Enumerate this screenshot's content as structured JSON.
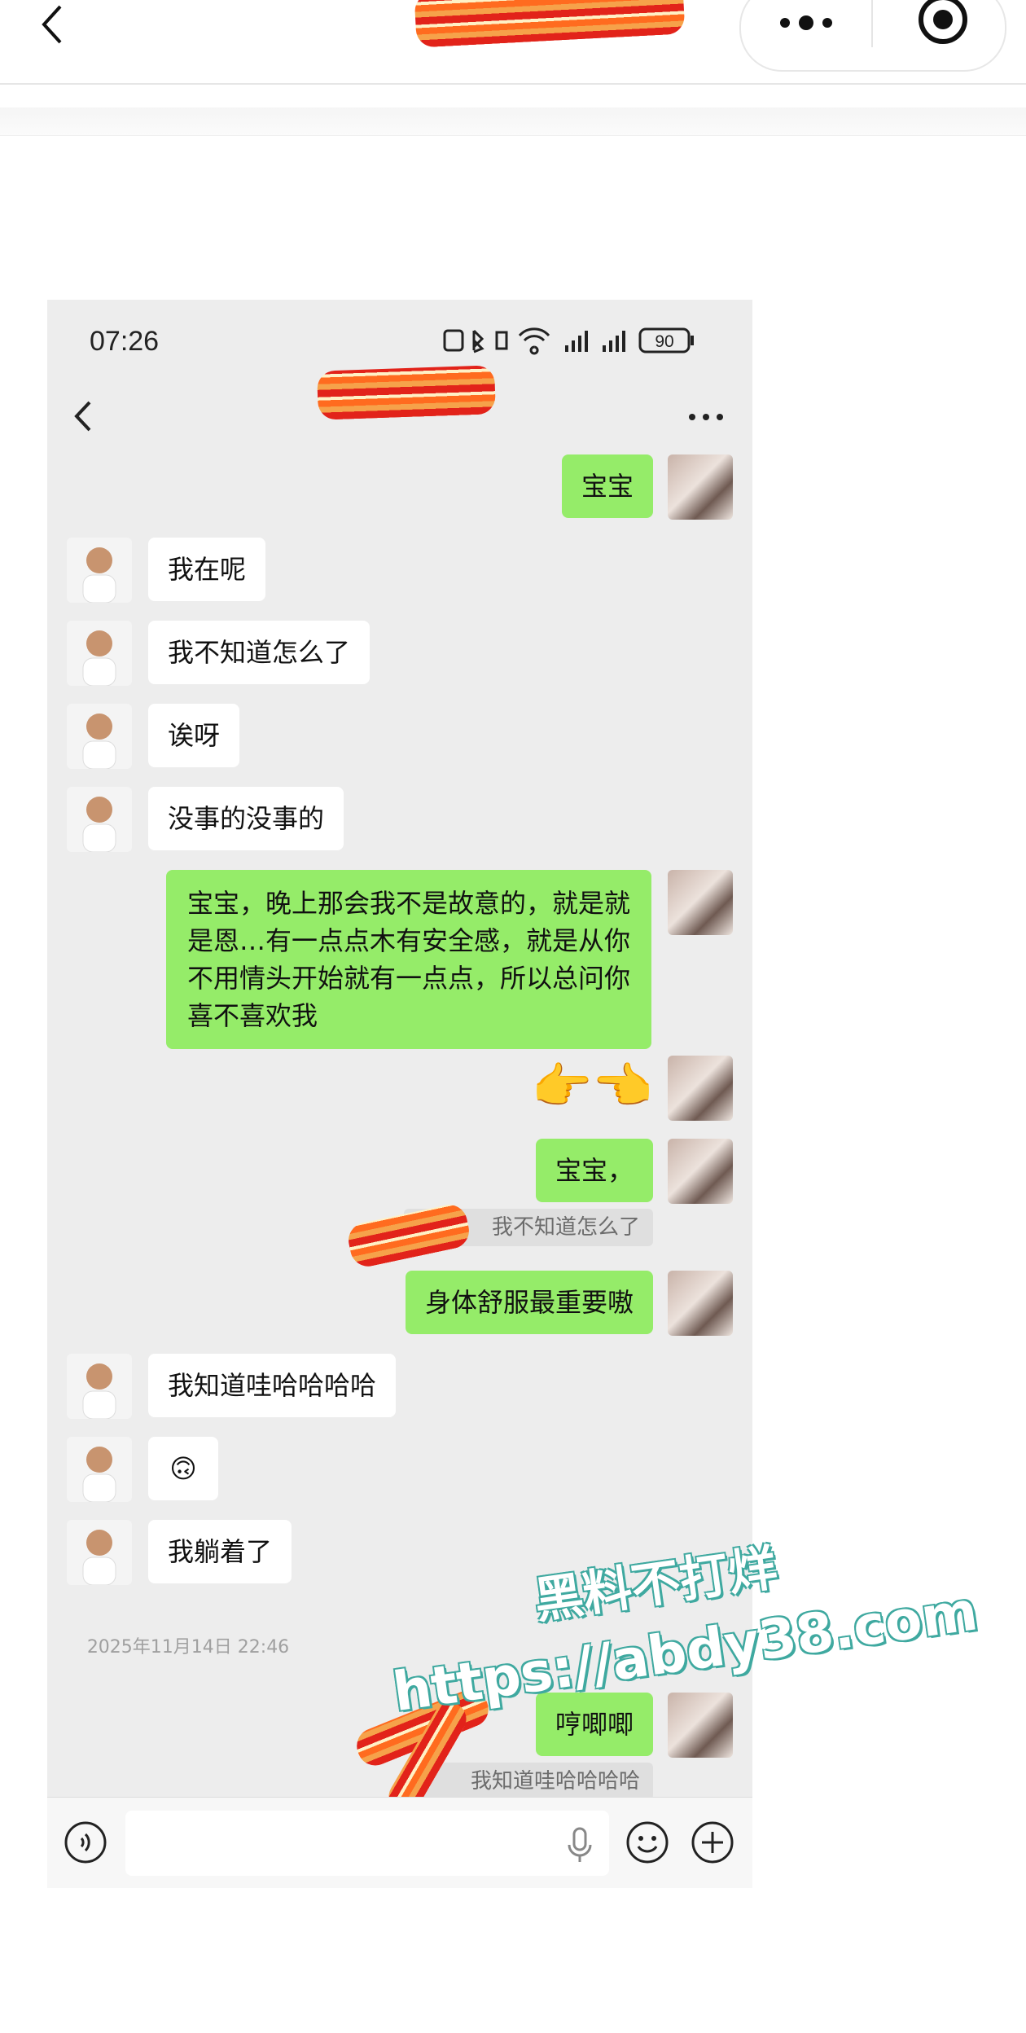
{
  "phone": {
    "status_time": "07:26",
    "battery": "90"
  },
  "messages": [
    {
      "side": "right",
      "text": "宝宝"
    },
    {
      "side": "left",
      "text": "我在呢"
    },
    {
      "side": "left",
      "text": "我不知道怎么了"
    },
    {
      "side": "left",
      "text": "诶呀"
    },
    {
      "side": "left",
      "text": "没事的没事的"
    },
    {
      "side": "right",
      "text": "宝宝，晚上那会我不是故意的，就是就是恩…有一点点木有安全感，就是从你不用情头开始就有一点点，所以总问你喜不喜欢我"
    },
    {
      "side": "right",
      "text": "👉👈"
    },
    {
      "side": "right",
      "text": "宝宝，"
    },
    {
      "side": "quote",
      "text": "我不知道怎么了"
    },
    {
      "side": "right",
      "text": "身体舒服最重要嗷"
    },
    {
      "side": "left",
      "text": "我知道哇哈哈哈哈"
    },
    {
      "side": "left",
      "text": "🙃"
    },
    {
      "side": "left",
      "text": "我躺着了"
    },
    {
      "side": "time",
      "text": "2025年11月14日 22:46"
    },
    {
      "side": "right",
      "text": "哼唧唧"
    },
    {
      "side": "quote",
      "text": "我知道哇哈哈哈哈"
    }
  ],
  "watermark": {
    "line1": "黑料不打烊",
    "line2": "https://abdy38.com"
  },
  "colors": {
    "bubble_self": "#95ec69",
    "bubble_other": "#ffffff",
    "chat_bg": "#ededed",
    "watermark_outline": "#3fa9a0"
  },
  "icons": [
    "back-arrow-icon",
    "more-dots-icon",
    "target-icon",
    "voice-icon",
    "mic-icon",
    "emoji-icon",
    "plus-icon"
  ]
}
